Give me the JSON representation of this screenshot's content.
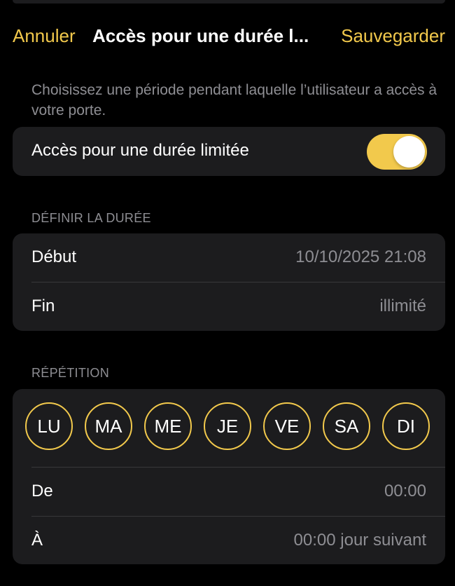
{
  "nav": {
    "cancel_label": "Annuler",
    "title": "Accès pour une durée l...",
    "save_label": "Sauvegarder"
  },
  "description": "Choisissez une période pendant laquelle l’utilisateur a accès à votre porte.",
  "limited_access": {
    "label": "Accès pour une durée limitée",
    "enabled": true
  },
  "duration_section": {
    "header": "DÉFINIR LA DURÉE",
    "start_label": "Début",
    "start_value": "10/10/2025 21:08",
    "end_label": "Fin",
    "end_value": "illimité"
  },
  "repeat_section": {
    "header": "RÉPÉTITION",
    "days": [
      "LU",
      "MA",
      "ME",
      "JE",
      "VE",
      "SA",
      "DI"
    ],
    "from_label": "De",
    "from_value": "00:00",
    "to_label": "À",
    "to_value": "00:00 jour suivant"
  },
  "colors": {
    "accent": "#f2c94c",
    "background": "#000000",
    "card": "#1c1c1e",
    "secondary_text": "#8e8e93"
  }
}
